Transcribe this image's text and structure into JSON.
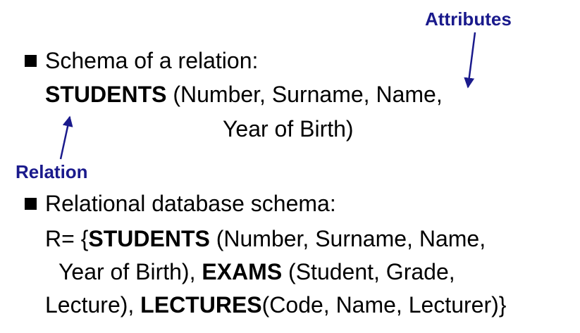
{
  "annotations": {
    "attributes_label": "Attributes",
    "relation_label": "Relation",
    "color": "#1a1a8c"
  },
  "bullet1": {
    "heading": "Schema of a relation:",
    "relation_name": "STUDENTS",
    "attrs_line1": " (Number, Surname, Name,",
    "attrs_line2": "Year of Birth)"
  },
  "bullet2": {
    "heading": "Relational database schema:",
    "line1_prefix": "R= {",
    "line1_rel": "STUDENTS",
    "line1_rest": " (Number, Surname, Name,",
    "line2_prefix": "Year of Birth), ",
    "line2_rel": "EXAMS",
    "line2_rest": " (Student, Grade,",
    "line3_prefix": "Lecture), ",
    "line3_rel": "LECTURES",
    "line3_rest": "(Code, Name, Lecturer)}"
  }
}
